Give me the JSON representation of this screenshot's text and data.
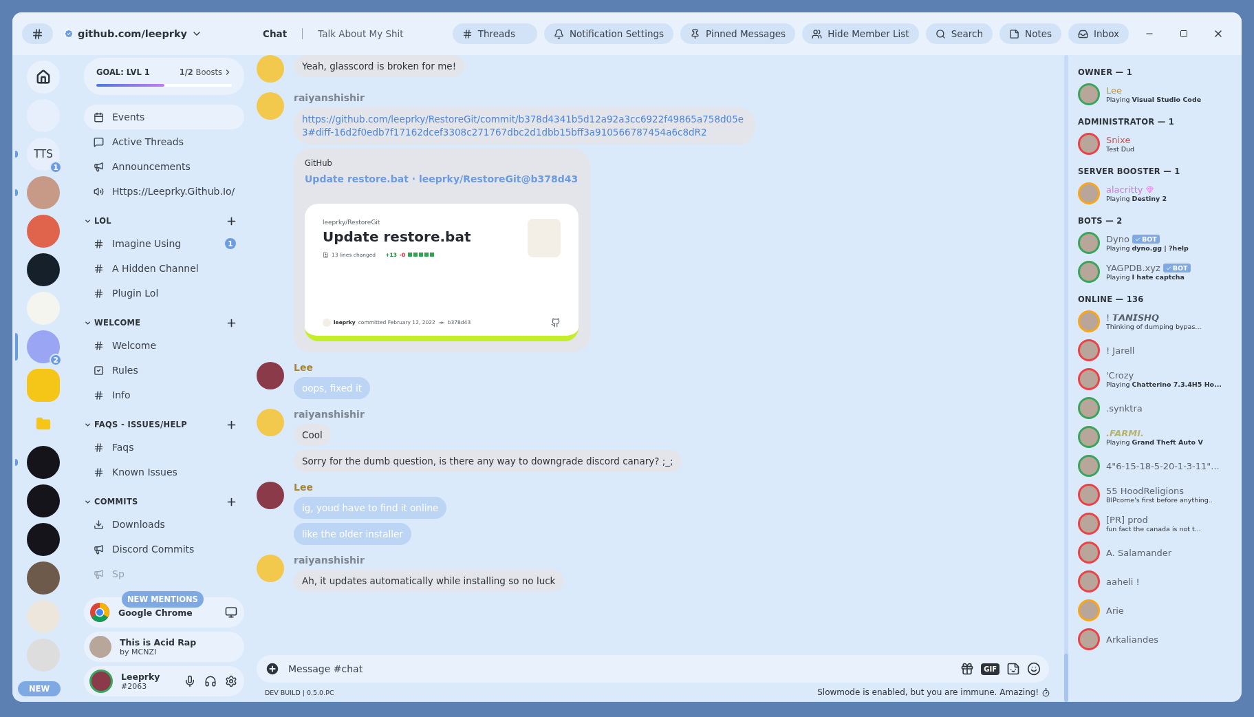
{
  "header": {
    "server_name": "github.com/leeprky",
    "tabs": [
      {
        "label": "Chat",
        "selected": true
      },
      {
        "label": "Talk About My Shit",
        "selected": false
      }
    ],
    "buttons": [
      {
        "kind": "threads",
        "label": "Threads"
      },
      {
        "kind": "bell",
        "label": "Notification Settings"
      },
      {
        "kind": "pin",
        "label": "Pinned Messages"
      },
      {
        "kind": "members",
        "label": "Hide Member List"
      },
      {
        "kind": "search",
        "label": "Search"
      },
      {
        "kind": "notes",
        "label": "Notes"
      },
      {
        "kind": "inbox",
        "label": "Inbox"
      }
    ]
  },
  "servers": [
    {
      "kind": "home",
      "unread": false,
      "selected": false
    },
    {
      "kind": "photo",
      "unread": false,
      "selected": false
    },
    {
      "kind": "text",
      "label": "TTS",
      "badge": "1",
      "unread": true,
      "selected": false
    },
    {
      "kind": "photo",
      "unread": true,
      "selected": false
    },
    {
      "kind": "photo",
      "unread": false,
      "selected": false
    },
    {
      "kind": "photo",
      "unread": false,
      "selected": false
    },
    {
      "kind": "photo",
      "unread": false,
      "selected": false
    },
    {
      "kind": "photo",
      "badge": "2",
      "unread": false,
      "selected": true
    },
    {
      "kind": "photo",
      "unread": false,
      "selected": false
    },
    {
      "kind": "folder",
      "unread": false,
      "selected": false
    },
    {
      "kind": "photo",
      "unread": true,
      "selected": false
    },
    {
      "kind": "photo",
      "unread": false,
      "selected": false
    },
    {
      "kind": "photo",
      "unread": false,
      "selected": false
    },
    {
      "kind": "photo",
      "unread": false,
      "selected": false
    },
    {
      "kind": "photo",
      "unread": false,
      "selected": false
    },
    {
      "kind": "photo",
      "unread": false,
      "selected": false
    }
  ],
  "new_pill": "NEW",
  "boost_goal": {
    "label": "GOAL: LVL 1",
    "progress": "**1/2** Boosts",
    "level": 0.5
  },
  "top_items": [
    {
      "kind": "events",
      "label": "Events",
      "selected": true
    },
    {
      "kind": "threads",
      "label": "Active Threads",
      "selected": false
    },
    {
      "kind": "announcement",
      "label": "Announcements",
      "selected": false
    },
    {
      "kind": "stage",
      "label": "Https://Leeprky.Github.Io/",
      "selected": false
    }
  ],
  "categories": [
    {
      "name": "LOL",
      "expanded": true,
      "channels": [
        {
          "kind": "text-thread",
          "name": "Imagine Using",
          "unread": true,
          "badge": "1",
          "muted": false
        },
        {
          "kind": "text-thread",
          "name": "A Hidden Channel",
          "unread": false,
          "muted": false
        },
        {
          "kind": "text-thread",
          "name": "Plugin Lol",
          "unread": false,
          "muted": false
        }
      ]
    },
    {
      "name": "WELCOME",
      "expanded": true,
      "channels": [
        {
          "kind": "text",
          "name": "Welcome",
          "unread": false,
          "muted": false
        },
        {
          "kind": "rules",
          "name": "Rules",
          "unread": false,
          "muted": false
        },
        {
          "kind": "text",
          "name": "Info",
          "unread": false,
          "muted": false
        }
      ]
    },
    {
      "name": "FAQS - ISSUES/HELP",
      "expanded": true,
      "channels": [
        {
          "kind": "text",
          "name": "Faqs",
          "unread": false,
          "muted": false
        },
        {
          "kind": "text",
          "name": "Known Issues",
          "unread": false,
          "muted": false
        }
      ]
    },
    {
      "name": "COMMITS",
      "expanded": true,
      "channels": [
        {
          "kind": "download",
          "name": "Downloads",
          "unread": false,
          "muted": false
        },
        {
          "kind": "announcement",
          "name": "Discord Commits",
          "unread": true,
          "muted": false
        },
        {
          "kind": "announcement",
          "name": "Sp",
          "unread": false,
          "muted": true
        }
      ]
    }
  ],
  "new_mentions": "NEW MENTIONS",
  "activity": {
    "app": "Google Chrome"
  },
  "music": {
    "title": "This is Acid Rap",
    "artist": "by MCNZI"
  },
  "user": {
    "name": "Leeprky",
    "tag": "#2063"
  },
  "messages": [
    {
      "kind": "plain",
      "messages": [
        {
          "kind": "text",
          "text": "Yeah, glasscord is broken for me!"
        }
      ]
    },
    {
      "author": "raiyanshishir",
      "kind": "plain",
      "messages": [
        {
          "kind": "link",
          "text": "https://github.com/leeprky/RestoreGit/commit/b378d4341b5d12a92a3cc6922f49865a758d05e3#diff-16d2f0edb7f17162dcef3308c271767dbc2d1dbb15bff3a910566787454a6c8dR2"
        },
        {
          "kind": "embed",
          "provider": "GitHub",
          "title": "Update restore.bat · leeprky/RestoreGit@b378d43",
          "card": {
            "repo": "leeprky/RestoreGit",
            "title": "Update restore.bat",
            "lines": "13 lines changed",
            "added": "+13",
            "removed": "-0",
            "author": "leeprky",
            "committed": "committed February 12, 2022",
            "hash": "b378d43"
          }
        }
      ]
    },
    {
      "author": "Lee",
      "kind": "owner",
      "messages": [
        {
          "kind": "own",
          "text": "oops, fixed it"
        }
      ]
    },
    {
      "author": "raiyanshishir",
      "kind": "plain",
      "messages": [
        {
          "kind": "text",
          "text": "Cool"
        },
        {
          "kind": "text",
          "text": "Sorry for the dumb question, is there any way to downgrade discord canary? ;_;"
        }
      ]
    },
    {
      "author": "Lee",
      "kind": "owner",
      "messages": [
        {
          "kind": "own",
          "text": "ig, youd have to find it online"
        },
        {
          "kind": "own",
          "text": "like the older installer"
        }
      ]
    },
    {
      "author": "raiyanshishir",
      "kind": "plain",
      "messages": [
        {
          "kind": "text",
          "text": "Ah, it updates automatically while installing so no luck"
        }
      ]
    }
  ],
  "composer": {
    "placeholder": "Message #chat",
    "gif": "GIF"
  },
  "footer": {
    "build": "DEV BUILD | 0.5.0.PC",
    "slowmode": "Slowmode is enabled, but you are immune. Amazing!"
  },
  "member_groups": [
    {
      "title": "OWNER — 1",
      "members": [
        {
          "name": "Lee",
          "kind": "owner",
          "color": "#3ba55c",
          "activity": "Playing **Visual Studio Code**",
          "bot": false
        }
      ]
    },
    {
      "title": "ADMINISTRATOR — 1",
      "members": [
        {
          "name": "Snixe",
          "kind": "admin",
          "color": "#ed4245",
          "activity": "Test Dud",
          "bot": false
        }
      ]
    },
    {
      "title": "SERVER BOOSTER — 1",
      "members": [
        {
          "name": "alacritty",
          "kind": "booster",
          "color": "#faa61a",
          "activity": "Playing **Destiny 2**",
          "bot": false
        }
      ]
    },
    {
      "title": "BOTS — 2",
      "members": [
        {
          "name": "Dyno",
          "kind": "plain",
          "color": "#3ba55c",
          "activity": "Playing **dyno.gg | ?help**",
          "bot": true,
          "bot_label": "BOT"
        },
        {
          "name": "YAGPDB.xyz",
          "kind": "plain",
          "color": "#3ba55c",
          "activity": "Playing **I hate captcha**",
          "bot": true,
          "bot_label": "BOT"
        }
      ]
    },
    {
      "title": "ONLINE — 136",
      "members": [
        {
          "name": "! 𝙏𝘼𝙉𝙄𝙎𝙃𝙌",
          "kind": "styled",
          "color": "#faa61a",
          "activity": "Thinking of dumping bypas...",
          "bot": false
        },
        {
          "name": "! Jarell",
          "kind": "plain",
          "color": "#ed4245",
          "bot": false
        },
        {
          "name": "'Crozy",
          "kind": "plain",
          "color": "#ed4245",
          "activity": "Playing **Chatterino 7.3.4H5 Ho...**",
          "bot": false
        },
        {
          "name": ".synktra",
          "kind": "plain",
          "color": "#3ba55c",
          "bot": false
        },
        {
          "name": ".FARMI.",
          "kind": "farmer",
          "color": "#3ba55c",
          "activity": "Playing **Grand Theft Auto V**",
          "bot": false
        },
        {
          "name": "4\"6-15-18-5-20-1-3-11\"...",
          "kind": "plain",
          "color": "#3ba55c",
          "bot": false
        },
        {
          "name": "55 HoodReligions",
          "kind": "plain",
          "color": "#ed4245",
          "activity": "BIPcome's first before anything..",
          "bot": false
        },
        {
          "name": "[PR] prod",
          "kind": "plain",
          "color": "#ed4245",
          "activity": "fun fact the canada is not t...",
          "bot": false
        },
        {
          "name": "A. Salamander",
          "kind": "plain",
          "color": "#ed4245",
          "bot": false
        },
        {
          "name": "aaheli !",
          "kind": "plain",
          "color": "#ed4245",
          "bot": false
        },
        {
          "name": "Arie",
          "kind": "plain",
          "color": "#faa61a",
          "bot": false
        },
        {
          "name": "Arkaliandes",
          "kind": "plain",
          "color": "#ed4245",
          "bot": false
        }
      ]
    }
  ]
}
